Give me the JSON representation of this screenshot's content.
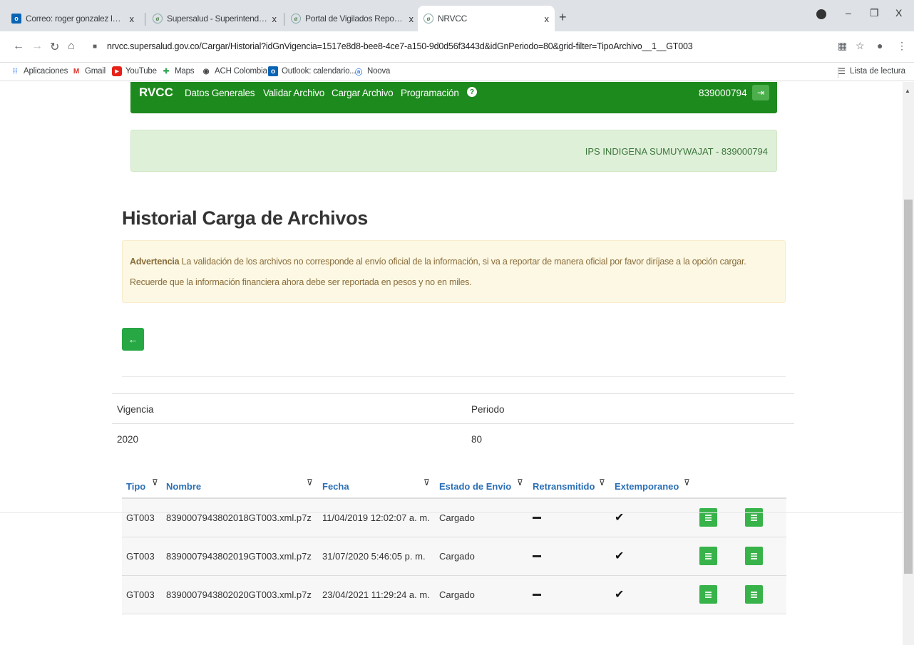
{
  "browser": {
    "tabs": [
      {
        "title": "Correo: roger gonzalez lobo - Ou",
        "icon": "outlook-icon",
        "active": false
      },
      {
        "title": "Supersalud - Superintendencia N",
        "icon": "leaf-icon",
        "active": false
      },
      {
        "title": "Portal de Vigilados Reporte de C",
        "icon": "leaf-icon",
        "active": false
      },
      {
        "title": "NRVCC",
        "icon": "leaf-icon",
        "active": true
      }
    ],
    "tab_close_glyph": "x",
    "new_tab_glyph": "+",
    "window": {
      "minimize": "–",
      "restore": "❐",
      "close": "X"
    },
    "url": "nrvcc.supersalud.gov.co/Cargar/Historial?idGnVigencia=1517e8d8-bee8-4ce7-a150-9d0d56f3443d&idGnPeriodo=80&grid-filter=TipoArchivo__1__GT003",
    "bookmarks": [
      {
        "label": "Aplicaciones",
        "icon": "apps-grid-icon"
      },
      {
        "label": "Gmail",
        "icon": "gmail-icon"
      },
      {
        "label": "YouTube",
        "icon": "youtube-icon"
      },
      {
        "label": "Maps",
        "icon": "maps-icon"
      },
      {
        "label": "ACH Colombia",
        "icon": "globe-icon"
      },
      {
        "label": "Outlook: calendario...",
        "icon": "outlook-icon"
      },
      {
        "label": "Noova",
        "icon": "noova-icon"
      }
    ],
    "reading_list": "Lista de lectura"
  },
  "navbar": {
    "brand": "RVCC",
    "links": [
      "Datos Generales",
      "Validar Archivo",
      "Cargar Archivo",
      "Programación"
    ],
    "help_glyph": "?",
    "nit": "839000794",
    "logout_glyph": "⇥"
  },
  "entity": "IPS INDIGENA SUMUYWAJAT - 839000794",
  "page_title": "Historial Carga de Archivos",
  "warning": {
    "label": "Advertencia",
    "line1": " La validación de los archivos no corresponde al envío oficial de la información, si va a reportar de manera oficial por favor diríjase a la opción cargar.",
    "line2": "Recuerde que la información financiera ahora debe ser reportada en pesos y no en miles."
  },
  "back_glyph": "←",
  "meta": {
    "vigencia_label": "Vigencia",
    "periodo_label": "Periodo",
    "vigencia": "2020",
    "periodo": "80"
  },
  "grid": {
    "headers": [
      "Tipo",
      "Nombre",
      "Fecha",
      "Estado de Envio",
      "Retransmitido",
      "Extemporaneo"
    ],
    "filter_glyph": "⊽",
    "rows": [
      {
        "tipo": "GT003",
        "nombre": "8390007943802018GT003.xml.p7z",
        "fecha": "11/04/2019 12:02:07 a. m.",
        "estado": "Cargado",
        "retransmitido": false,
        "extemporaneo": true
      },
      {
        "tipo": "GT003",
        "nombre": "8390007943802019GT003.xml.p7z",
        "fecha": "31/07/2020 5:46:05 p. m.",
        "estado": "Cargado",
        "retransmitido": false,
        "extemporaneo": true
      },
      {
        "tipo": "GT003",
        "nombre": "8390007943802020GT003.xml.p7z",
        "fecha": "23/04/2021 11:29:24 a. m.",
        "estado": "Cargado",
        "retransmitido": false,
        "extemporaneo": true
      }
    ],
    "check_glyph": "✔"
  },
  "colors": {
    "navbar": "#1d8a1d",
    "success_bg": "#dff0d8",
    "warning_bg": "#fcf8e3",
    "link": "#2a6fb5",
    "action_button": "#37b34a"
  }
}
